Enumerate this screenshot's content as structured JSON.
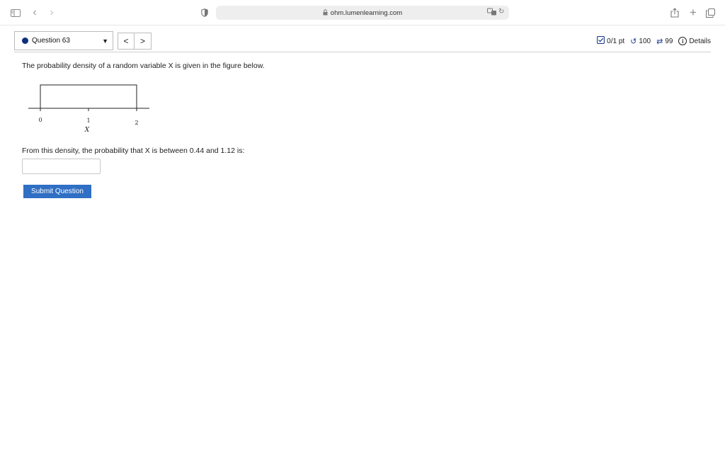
{
  "browser": {
    "url": "ohm.lumenlearning.com"
  },
  "question_nav": {
    "selected_question": "Question 63",
    "prev_label": "<",
    "next_label": ">",
    "score": "0/1 pt",
    "attempts": "100",
    "retries": "99",
    "details_label": "Details"
  },
  "question": {
    "prompt": "The probability density of a random variable X is given in the figure below.",
    "figure": {
      "tick_labels": [
        "0",
        "1",
        "2"
      ],
      "axis_label": "X"
    },
    "sub_prompt": "From this density, the probability that X is between 0.44 and 1.12 is:",
    "answer_value": "",
    "submit_label": "Submit Question"
  },
  "colors": {
    "accent": "#2f6fc4",
    "dot": "#0f2f7f"
  }
}
